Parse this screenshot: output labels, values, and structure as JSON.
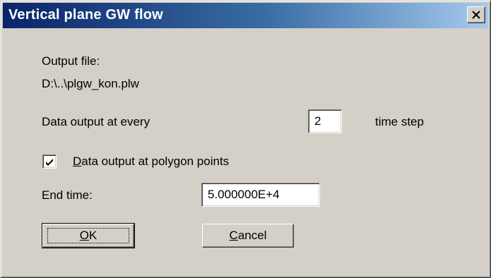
{
  "window": {
    "title": "Vertical plane GW flow",
    "close_icon": "close-icon"
  },
  "output": {
    "label": "Output file:",
    "path": "D:\\..\\plgw_kon.plw"
  },
  "data_output": {
    "label": "Data output at every",
    "value": "2",
    "unit": "time step"
  },
  "polygon_points": {
    "checked": true,
    "label_mnemonic": "D",
    "label_rest": "ata output at polygon points"
  },
  "end_time": {
    "label": "End time:",
    "value": "5.000000E+4"
  },
  "buttons": {
    "ok_mnemonic": "O",
    "ok_rest": "K",
    "cancel_mnemonic": "C",
    "cancel_rest": "ancel"
  },
  "colors": {
    "titlebar_start": "#0a246a",
    "titlebar_end": "#a6caf0",
    "face": "#d4d0c8"
  }
}
